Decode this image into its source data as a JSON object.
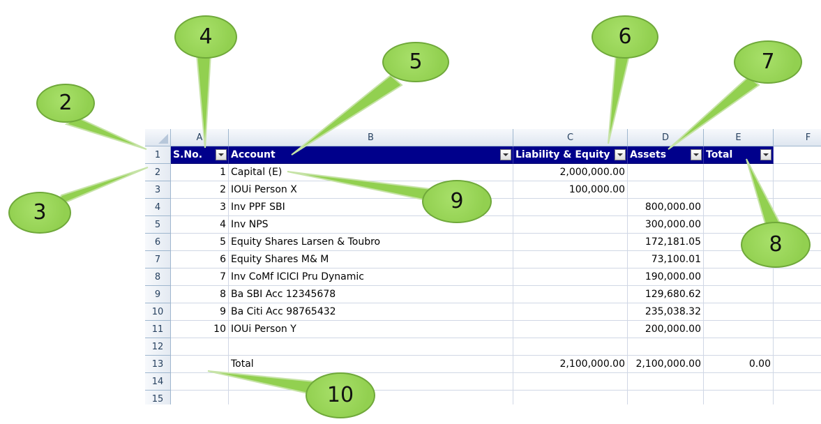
{
  "columns": [
    "A",
    "B",
    "C",
    "D",
    "E",
    "F"
  ],
  "rows": [
    "1",
    "2",
    "3",
    "4",
    "5",
    "6",
    "7",
    "8",
    "9",
    "10",
    "11",
    "12",
    "13",
    "14",
    "15"
  ],
  "header": {
    "sno": "S.No.",
    "account": "Account",
    "liability": "Liability & Equity",
    "assets": "Assets",
    "total": "Total"
  },
  "data": [
    {
      "sno": "1",
      "account": "Capital (E)",
      "liability": "2,000,000.00",
      "assets": "",
      "total": ""
    },
    {
      "sno": "2",
      "account": "IOUi Person X",
      "liability": "100,000.00",
      "assets": "",
      "total": ""
    },
    {
      "sno": "3",
      "account": "Inv PPF SBI",
      "liability": "",
      "assets": "800,000.00",
      "total": ""
    },
    {
      "sno": "4",
      "account": "Inv NPS",
      "liability": "",
      "assets": "300,000.00",
      "total": ""
    },
    {
      "sno": "5",
      "account": "Equity Shares Larsen & Toubro",
      "liability": "",
      "assets": "172,181.05",
      "total": ""
    },
    {
      "sno": "6",
      "account": "Equity Shares M& M",
      "liability": "",
      "assets": "73,100.01",
      "total": ""
    },
    {
      "sno": "7",
      "account": "Inv CoMf ICICI Pru Dynamic",
      "liability": "",
      "assets": "190,000.00",
      "total": ""
    },
    {
      "sno": "8",
      "account": "Ba SBI Acc 12345678",
      "liability": "",
      "assets": "129,680.62",
      "total": ""
    },
    {
      "sno": "9",
      "account": "Ba Citi Acc 98765432",
      "liability": "",
      "assets": "235,038.32",
      "total": ""
    },
    {
      "sno": "10",
      "account": "IOUi Person Y",
      "liability": "",
      "assets": "200,000.00",
      "total": ""
    },
    {
      "sno": "",
      "account": "",
      "liability": "",
      "assets": "",
      "total": ""
    },
    {
      "sno": "",
      "account": "Total",
      "liability": "2,100,000.00",
      "assets": "2,100,000.00",
      "total": "0.00"
    },
    {
      "sno": "",
      "account": "",
      "liability": "",
      "assets": "",
      "total": ""
    },
    {
      "sno": "",
      "account": "",
      "liability": "",
      "assets": "",
      "total": ""
    }
  ],
  "callouts": [
    "2",
    "3",
    "4",
    "5",
    "6",
    "7",
    "8",
    "9",
    "10"
  ],
  "colors": {
    "header_bg": "#00008b",
    "callout": "#92d050"
  }
}
